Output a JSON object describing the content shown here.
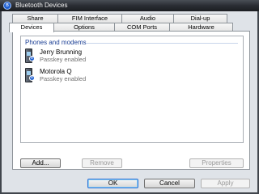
{
  "window": {
    "title": "Bluetooth Devices"
  },
  "tabs_back": [
    {
      "label": "Share"
    },
    {
      "label": "FIM Interface"
    },
    {
      "label": "Audio"
    },
    {
      "label": "Dial-up"
    }
  ],
  "tabs_front": [
    {
      "label": "Devices",
      "active": true
    },
    {
      "label": "Options"
    },
    {
      "label": "COM Ports"
    },
    {
      "label": "Hardware"
    }
  ],
  "device_list": {
    "group_label": "Phones and modems",
    "devices": [
      {
        "name": "Jerry Brunning",
        "status": "Passkey enabled",
        "icon": "phone-icon"
      },
      {
        "name": "Motorola Q",
        "status": "Passkey enabled",
        "icon": "phone-icon"
      }
    ]
  },
  "panel_buttons": {
    "add": "Add...",
    "remove": "Remove",
    "properties": "Properties"
  },
  "dialog_buttons": {
    "ok": "OK",
    "cancel": "Cancel",
    "apply": "Apply"
  },
  "colors": {
    "title_bar": "#2a2d33",
    "dialog_bg": "#dfe3e8",
    "group_header": "#1a3e94",
    "default_button_focus": "#2f6fd6"
  }
}
